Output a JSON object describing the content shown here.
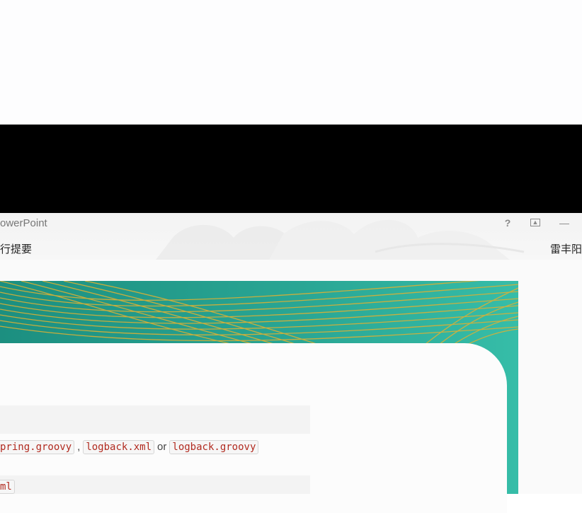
{
  "window": {
    "app_title": "owerPoint",
    "help_label": "?",
    "restore_label": "▲",
    "minimize_label": "—"
  },
  "ribbon": {
    "tab_text": "行提要",
    "user_name": "雷丰阳"
  },
  "slide": {
    "theme_colors": {
      "teal": "#26a492",
      "gold": "#d9b036",
      "panel": "#fcfcfc"
    },
    "code_line": {
      "part1": "pring.groovy",
      "sep1": ",",
      "part2": "logback.xml",
      "sep2": "or",
      "part3": "logback.groovy"
    },
    "code_line2": "ml"
  }
}
